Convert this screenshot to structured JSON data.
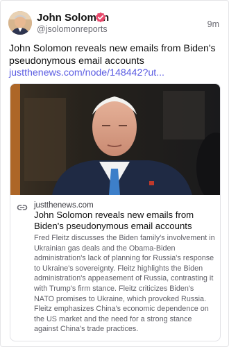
{
  "post": {
    "author_name": "John Solomon",
    "handle": "@jsolomonreports",
    "timestamp": "9m",
    "verified_color": "#e8486b",
    "text": "John Solomon reveals new emails from Biden's pseudonymous email accounts ",
    "link_text": "justthenews.com/node/148442?ut..."
  },
  "link_card": {
    "domain": "justthenews.com",
    "title": "John Solomon reveals new emails from Biden's pseudonymous email accounts",
    "description": "Fred Fleitz discusses the Biden family's involvement in Ukrainian gas deals and the Obama-Biden administration's lack of planning for Russia's response to Ukraine's sovereignty. Fleitz highlights the Biden administration's appeasement of Russia, contrasting it with Trump's firm stance. Fleitz criticizes Biden's NATO promises to Ukraine, which provoked Russia. Fleitz emphasizes China's economic dependence on the US market and the need for a strong stance against China's trade practices."
  },
  "colors": {
    "link": "#5b5ce2",
    "secondary_text": "#6b6b73",
    "border": "#e2e2e6"
  },
  "icons": {
    "verified": "verified-badge-icon",
    "link": "link-chain-icon"
  }
}
